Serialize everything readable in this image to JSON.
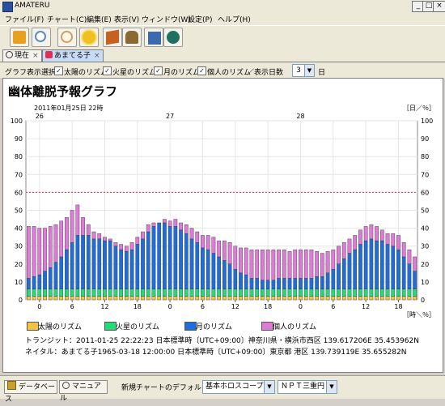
{
  "window": {
    "title": "AMATERU"
  },
  "menu": {
    "items": [
      "ファイル(F)",
      "チャート(C)",
      "編集(E)",
      "表示(V)",
      "ウィンドウ(W)",
      "設定(P)",
      "ヘルプ(H)"
    ]
  },
  "toolbar": {
    "buttons": [
      {
        "icon": "new-chart-icon",
        "color": "#e8a020"
      },
      {
        "icon": "search-icon",
        "color": "#5a8ac8"
      },
      {
        "icon": "timer-icon",
        "color": "#c9a060"
      },
      {
        "icon": "sun-icon",
        "color": "#f0c020"
      },
      {
        "icon": "book-icon",
        "color": "#c86020"
      },
      {
        "icon": "person-icon",
        "color": "#8a6a30"
      },
      {
        "icon": "notes-icon",
        "color": "#3a6ab0"
      },
      {
        "icon": "globe-icon",
        "color": "#207060"
      }
    ]
  },
  "tabs": [
    {
      "label": "現在",
      "active": false
    },
    {
      "label": "あまてる子",
      "active": true
    }
  ],
  "options": {
    "label": "グラフ表示選択",
    "checks": [
      {
        "label": "太陽のリズム",
        "checked": true
      },
      {
        "label": "火星のリズム",
        "checked": true
      },
      {
        "label": "月のリズム",
        "checked": true
      },
      {
        "label": "個人のリズム",
        "checked": true
      }
    ],
    "days_label": "／表示日数",
    "days_value": "3",
    "days_unit": "日"
  },
  "heading": "幽体離脱予報グラフ",
  "chart_data": {
    "type": "bar",
    "stacked": true,
    "date_label": "2011年01月25日 22時",
    "y_unit_top": "［日／％］",
    "x_unit": "［時＼％］",
    "ylim": [
      0,
      100
    ],
    "y_ticks": [
      0,
      10,
      20,
      30,
      40,
      50,
      60,
      70,
      80,
      90,
      100
    ],
    "day_labels": [
      {
        "hour_index": 2,
        "label": "26"
      },
      {
        "hour_index": 26,
        "label": "27"
      },
      {
        "hour_index": 50,
        "label": "28"
      }
    ],
    "hour_ticks": [
      "0",
      "6",
      "12",
      "18",
      "0",
      "6",
      "12",
      "18",
      "0",
      "6",
      "12",
      "18"
    ],
    "hour_tick_index": [
      2,
      8,
      14,
      20,
      26,
      32,
      38,
      44,
      50,
      56,
      62,
      68
    ],
    "threshold": 60,
    "colors": {
      "sun": "#f5c342",
      "mars": "#22dd77",
      "moon": "#1e6ddc",
      "personal": "#e07ad8",
      "threshold": "#ff2a2a"
    },
    "series": [
      {
        "name": "太陽のリズム",
        "values": [
          2,
          2,
          2,
          2,
          2,
          2,
          2,
          2,
          2,
          2,
          2,
          2,
          2,
          2,
          2,
          2,
          2,
          2,
          2,
          2,
          2,
          2,
          2,
          2,
          2,
          2,
          2,
          2,
          2,
          2,
          2,
          2,
          2,
          2,
          2,
          2,
          2,
          2,
          2,
          2,
          2,
          2,
          2,
          2,
          2,
          2,
          2,
          2,
          2,
          2,
          2,
          2,
          2,
          2,
          2,
          2,
          2,
          2,
          2,
          2,
          2,
          2,
          2,
          2,
          2,
          2,
          2,
          2,
          2,
          2,
          2,
          2
        ]
      },
      {
        "name": "火星のリズム",
        "values": [
          4,
          4,
          4,
          4,
          4,
          4,
          4,
          4,
          4,
          4,
          4,
          4,
          4,
          4,
          4,
          4,
          4,
          4,
          4,
          4,
          4,
          4,
          4,
          4,
          4,
          4,
          4,
          4,
          4,
          4,
          4,
          4,
          4,
          4,
          4,
          4,
          4,
          4,
          4,
          4,
          4,
          4,
          4,
          4,
          4,
          4,
          4,
          4,
          4,
          4,
          4,
          4,
          4,
          4,
          4,
          4,
          4,
          4,
          4,
          4,
          4,
          4,
          4,
          4,
          4,
          4,
          4,
          4,
          4,
          4,
          4,
          4
        ]
      },
      {
        "name": "月のリズム",
        "values": [
          6,
          7,
          8,
          10,
          12,
          15,
          18,
          22,
          26,
          30,
          30,
          30,
          28,
          28,
          27,
          27,
          24,
          22,
          21,
          22,
          25,
          28,
          32,
          35,
          37,
          37,
          35,
          35,
          33,
          31,
          28,
          26,
          23,
          22,
          20,
          18,
          16,
          14,
          11,
          9,
          8,
          6,
          6,
          5,
          5,
          5,
          6,
          6,
          6,
          6,
          6,
          6,
          6,
          7,
          7,
          9,
          11,
          14,
          17,
          20,
          22,
          25,
          27,
          28,
          27,
          27,
          25,
          24,
          22,
          18,
          14,
          10
        ]
      },
      {
        "name": "個人のリズム",
        "values": [
          29,
          28,
          26,
          24,
          23,
          21,
          20,
          18,
          18,
          17,
          10,
          6,
          4,
          3,
          2,
          1,
          2,
          3,
          3,
          4,
          4,
          4,
          4,
          2,
          0,
          2,
          3,
          4,
          4,
          5,
          6,
          6,
          7,
          8,
          9,
          9,
          11,
          12,
          13,
          14,
          15,
          16,
          16,
          17,
          17,
          17,
          16,
          16,
          15,
          16,
          16,
          16,
          16,
          14,
          13,
          12,
          11,
          10,
          9,
          8,
          8,
          8,
          8,
          8,
          8,
          6,
          6,
          7,
          8,
          8,
          8,
          8
        ]
      }
    ]
  },
  "legend": [
    {
      "label": "太陽のリズム",
      "color": "#f5c342"
    },
    {
      "label": "火星のリズム",
      "color": "#22dd77"
    },
    {
      "label": "月のリズム",
      "color": "#1e6ddc"
    },
    {
      "label": "個人のリズム",
      "color": "#e07ad8"
    }
  ],
  "info": {
    "transit": "トランジット：2011-01-25 22:22:23 日本標準時〔UTC+09:00〕神奈川県・横浜市西区 139.617206E 35.453962N",
    "natal": "ネイタル：あまてる子1965-03-18 12:00:00 日本標準時〔UTC+09:00〕東京都 港区 139.739119E 35.655282N"
  },
  "statusbar": {
    "database_label": "データベース",
    "manual_label": "マニュアル",
    "default_label": "新規チャートのデフォルト",
    "scope_value": "基本ホロスコープ",
    "circle_value": "ＮＰＴ三重円"
  }
}
